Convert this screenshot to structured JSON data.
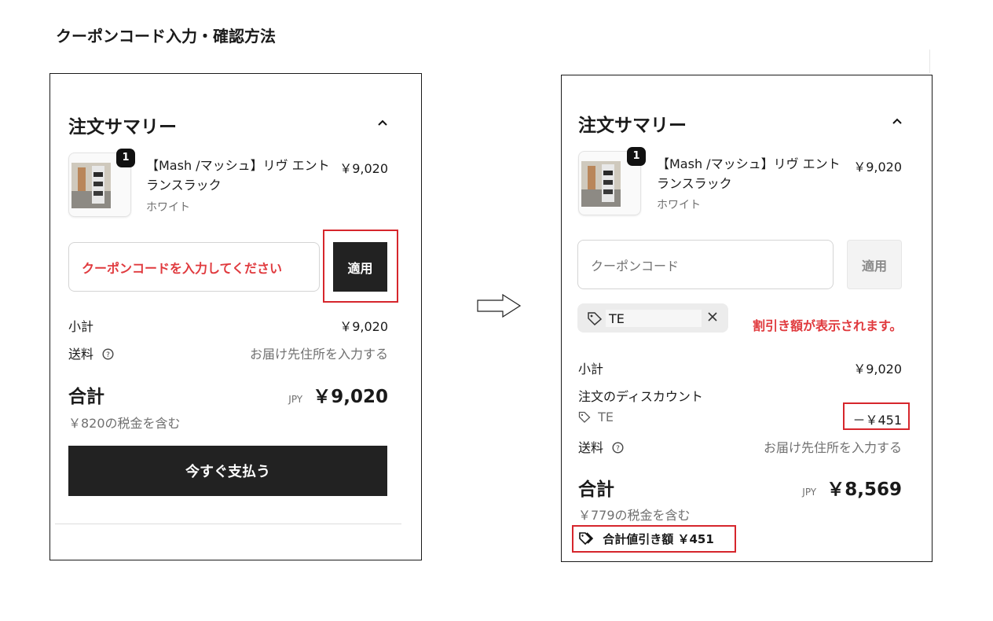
{
  "page_title": "クーポンコード入力・確認方法",
  "before": {
    "summary_title": "注文サマリー",
    "chevron": "^",
    "item": {
      "qty": "1",
      "name": "【Mash /マッシュ】リヴ エントランスラック",
      "variant": "ホワイト",
      "price": "￥9,020"
    },
    "coupon_placeholder": "クーポンコードを入力してください",
    "apply_label": "適用",
    "subtotal_label": "小計",
    "subtotal_value": "￥9,020",
    "shipping_label": "送料",
    "shipping_value": "お届け先住所を入力する",
    "total_label": "合計",
    "currency": "JPY",
    "total_value": "￥9,020",
    "tax_note": "￥820の税金を含む",
    "pay_label": "今すぐ支払う"
  },
  "after": {
    "summary_title": "注文サマリー",
    "chevron": "^",
    "item": {
      "qty": "1",
      "name": "【Mash /マッシュ】リヴ エントランスラック",
      "variant": "ホワイト",
      "price": "￥9,020"
    },
    "coupon_placeholder": "クーポンコード",
    "apply_label": "適用",
    "applied_code": "TE",
    "discount_note": "割引き額が表示されます。",
    "subtotal_label": "小計",
    "subtotal_value": "￥9,020",
    "discount_label": "注文のディスカウント",
    "discount_code": "TE",
    "discount_value": "－￥451",
    "shipping_label": "送料",
    "shipping_value": "お届け先住所を入力する",
    "total_label": "合計",
    "currency": "JPY",
    "total_value": "￥8,569",
    "tax_note": "￥779の税金を含む",
    "total_savings": "合計値引き額 ￥451"
  },
  "colors": {
    "highlight_red": "#d6262c",
    "dark_button": "#222222"
  }
}
